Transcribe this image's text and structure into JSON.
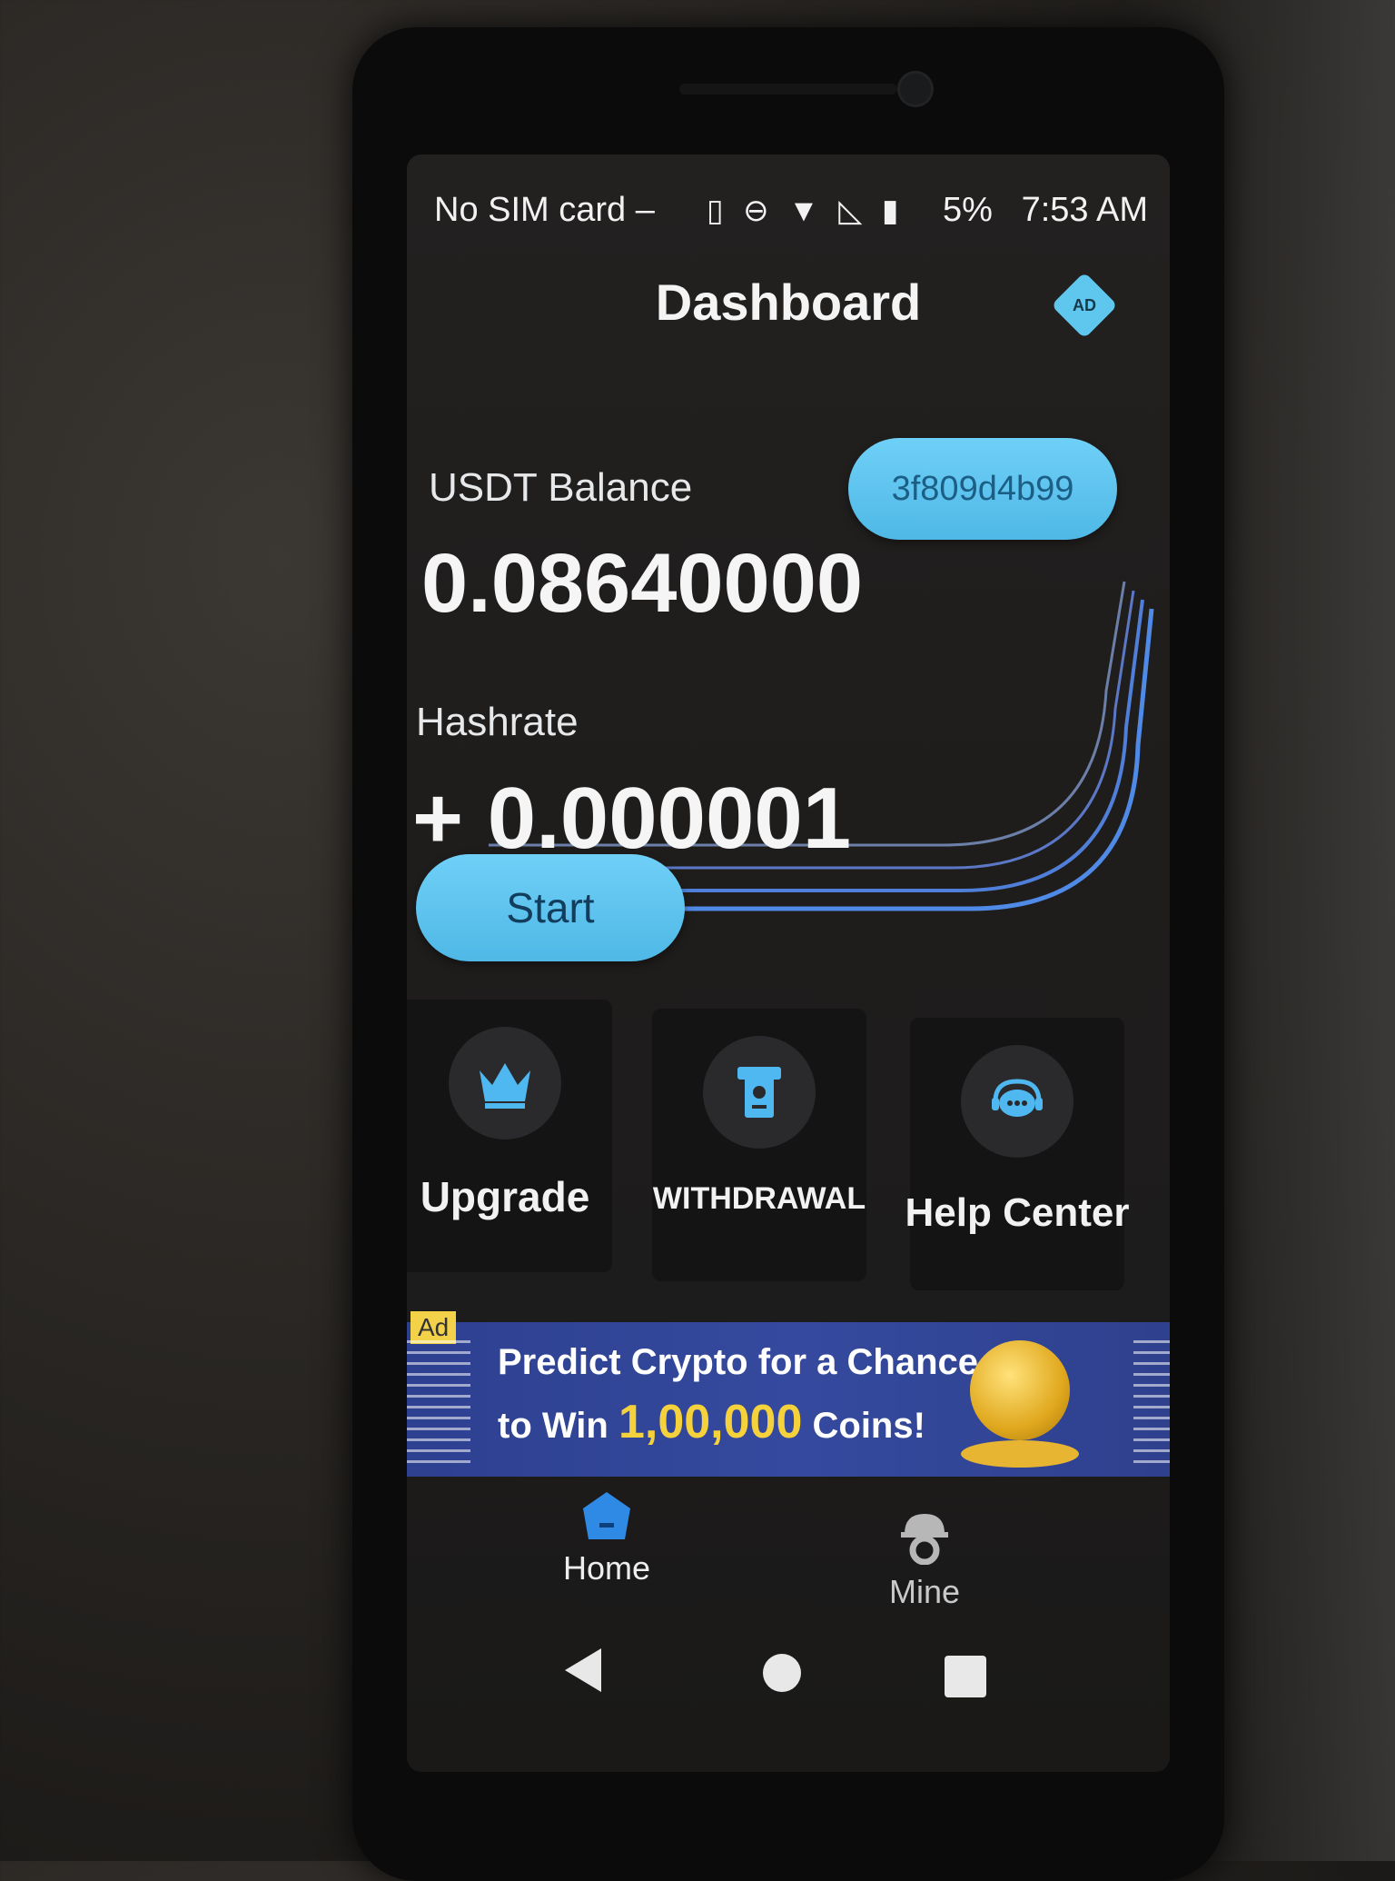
{
  "status_bar": {
    "carrier": "No SIM card –",
    "icons": [
      "vibrate-icon",
      "dnd-icon",
      "wifi-icon",
      "no-signal-icon",
      "battery-icon"
    ],
    "battery": "5%",
    "time": "7:53 AM"
  },
  "header": {
    "title": "Dashboard",
    "ad_badge": "AD"
  },
  "balance": {
    "label": "USDT Balance",
    "value": "0.08640000",
    "wallet_id": "3f809d4b99"
  },
  "hashrate": {
    "label": "Hashrate",
    "value": "+ 0.000001",
    "start_button": "Start"
  },
  "actions": [
    {
      "label": "Upgrade",
      "icon": "crown-icon"
    },
    {
      "label": "WITHDRAWAL",
      "icon": "atm-icon"
    },
    {
      "label": "Help Center",
      "icon": "support-chat-icon"
    }
  ],
  "ad_banner": {
    "tag": "Ad",
    "line1": "Predict Crypto for a Chance",
    "line2_prefix": "to Win",
    "line2_highlight": "1,00,000",
    "line2_suffix": "Coins!"
  },
  "bottom_nav": {
    "home": "Home",
    "mine": "Mine"
  },
  "colors": {
    "accent": "#5fc6ee",
    "card_line": "#4f7fd9",
    "banner": "#354a9e",
    "highlight": "#f5d13b"
  }
}
